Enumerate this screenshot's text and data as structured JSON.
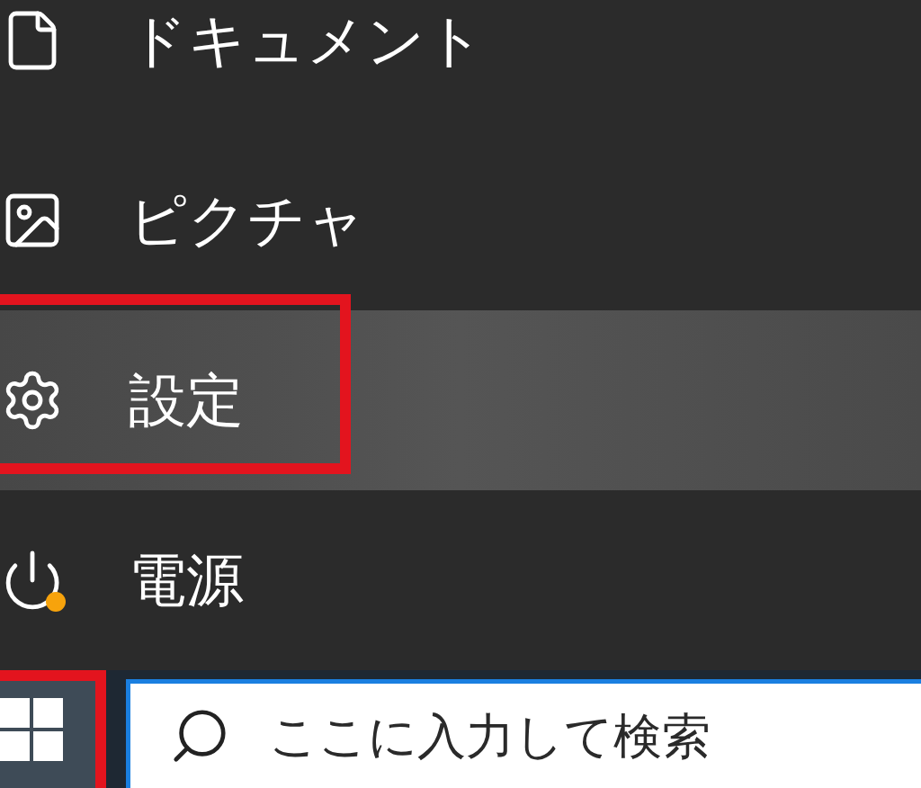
{
  "menu_items": [
    {
      "kind": "documents",
      "label": "ドキュメント",
      "selected": false,
      "outlined": false,
      "update_dot": false
    },
    {
      "kind": "pictures",
      "label": "ピクチャ",
      "selected": false,
      "outlined": false,
      "update_dot": false
    },
    {
      "kind": "settings",
      "label": "設定",
      "selected": true,
      "outlined": true,
      "update_dot": false
    },
    {
      "kind": "power",
      "label": "電源",
      "selected": false,
      "outlined": false,
      "update_dot": true
    }
  ],
  "taskbar": {
    "start_outlined": true,
    "search": {
      "placeholder": "ここに入力して検索"
    }
  }
}
